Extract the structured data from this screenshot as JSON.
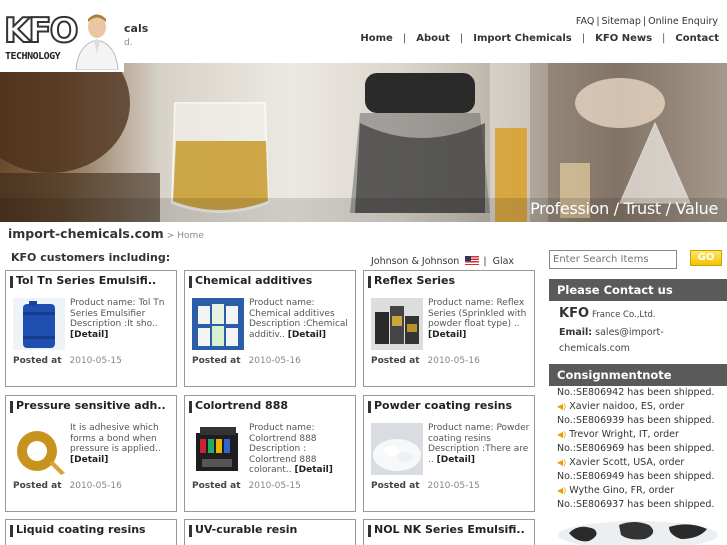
{
  "header": {
    "logo_text": "KFO",
    "logo_sub": "TECHNOLOGY",
    "logo_cut_1": "cals",
    "logo_cut_2": "d.",
    "top_links": [
      "FAQ",
      "Sitemap",
      "Online Enquiry"
    ],
    "nav": [
      "Home",
      "About",
      "Import Chemicals",
      "KFO News",
      "Contact"
    ]
  },
  "banner": {
    "tagline": "Profession / Trust / Value"
  },
  "breadcrumb": {
    "site": "import-chemicals.com",
    "home": "> Home"
  },
  "customers": {
    "heading": "KFO customers including:",
    "ticker_a": "Johnson & Johnson",
    "ticker_sep": "|",
    "ticker_b": "Glax"
  },
  "products": [
    {
      "title": "Tol Tn Series Emulsifi..",
      "desc": "Product name: Tol Tn Series Emulsifier Description :It sho..",
      "detail": "[Detail]",
      "posted_label": "Posted at",
      "date": "2010-05-15"
    },
    {
      "title": "Chemical additives",
      "desc": "Product name: Chemical additives Description :Chemical additiv..",
      "detail": "[Detail]",
      "posted_label": "Posted at",
      "date": "2010-05-16"
    },
    {
      "title": "Reflex Series",
      "desc": "Product name: Reflex Series (Sprinkled with powder float type) ..",
      "detail": "[Detail]",
      "posted_label": "Posted at",
      "date": "2010-05-16"
    },
    {
      "title": "Pressure sensitive adh..",
      "desc": "It is adhesive which forms a bond when pressure is applied..",
      "detail": "[Detail]",
      "posted_label": "Posted at",
      "date": "2010-05-16"
    },
    {
      "title": "Colortrend 888",
      "desc": "Product name: Colortrend 888 Description : Colortrend 888 colorant..",
      "detail": "[Detail]",
      "posted_label": "Posted at",
      "date": "2010-05-15"
    },
    {
      "title": "Powder coating resins",
      "desc": "Product name: Powder coating resins Description :There are ..",
      "detail": "[Detail]",
      "posted_label": "Posted at",
      "date": "2010-05-15"
    },
    {
      "title": "Liquid coating resins"
    },
    {
      "title": "UV-curable resin"
    },
    {
      "title": "NOL NK Series Emulsifi.."
    }
  ],
  "search": {
    "placeholder": "Enter Search Items",
    "button": "GO"
  },
  "contact": {
    "heading": "Please Contact us",
    "company_brand": "KFO",
    "company_rest": "France Co.,Ltd.",
    "email_label": "Email:",
    "email": "sales@import-chemicals.com"
  },
  "consignment": {
    "heading": "Consignmentnote",
    "items": [
      "No.:SE806942 has been shipped.",
      "Xavier naidoo, ES, order No.:SE806939 has been shipped.",
      "Trevor Wright, IT, order No.:SE806969 has been shipped.",
      "Xavier Scott, USA, order No.:SE806949 has been shipped.",
      "Wythe Gino, FR, order No.:SE806937 has been shipped."
    ]
  },
  "colors": {
    "header_bar": "#5a5a5a",
    "go_button": "#f2c400",
    "accent_bar": "#333333"
  }
}
